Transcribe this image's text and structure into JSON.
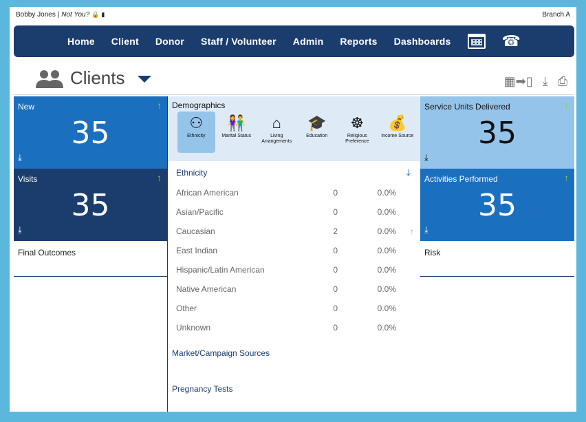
{
  "topbar": {
    "user": "Bobby Jones |",
    "not_you": "Not You?",
    "branch": "Branch A"
  },
  "nav": {
    "items": [
      "Home",
      "Client",
      "Donor",
      "Staff / Volunteer",
      "Admin",
      "Reports",
      "Dashboards"
    ]
  },
  "header": {
    "title": "Clients"
  },
  "tiles": {
    "new": {
      "label": "New",
      "value": "35"
    },
    "visits": {
      "label": "Visits",
      "value": "35"
    },
    "service_units": {
      "label": "Service Units Delivered",
      "value": "35"
    },
    "activities": {
      "label": "Activities Performed",
      "value": "35"
    }
  },
  "left_sections": {
    "final_outcomes": "Final Outcomes"
  },
  "right_sections": {
    "risk": "Risk"
  },
  "demographics": {
    "title": "Demographics",
    "categories": [
      {
        "label": "Ethnicity",
        "icon": "ethnicity-icon"
      },
      {
        "label": "Marital Status",
        "icon": "marital-status-icon"
      },
      {
        "label": "Living Arrangements",
        "icon": "living-arrangements-icon"
      },
      {
        "label": "Education",
        "icon": "education-icon"
      },
      {
        "label": "Religious Preference",
        "icon": "religious-preference-icon"
      },
      {
        "label": "Income Source",
        "icon": "income-source-icon"
      }
    ]
  },
  "ethnicity": {
    "title": "Ethnicity",
    "rows": [
      {
        "name": "African American",
        "count": "0",
        "pct": "0.0%",
        "up": ""
      },
      {
        "name": "Asian/Pacific",
        "count": "0",
        "pct": "0.0%",
        "up": ""
      },
      {
        "name": "Caucasian",
        "count": "2",
        "pct": "0.0%",
        "up": "↑"
      },
      {
        "name": "East Indian",
        "count": "0",
        "pct": "0.0%",
        "up": ""
      },
      {
        "name": "Hispanic/Latin American",
        "count": "0",
        "pct": "0.0%",
        "up": ""
      },
      {
        "name": "Native American",
        "count": "0",
        "pct": "0.0%",
        "up": ""
      },
      {
        "name": "Other",
        "count": "0",
        "pct": "0.0%",
        "up": ""
      },
      {
        "name": "Unknown",
        "count": "0",
        "pct": "0.0%",
        "up": ""
      }
    ]
  },
  "sections": {
    "market": "Market/Campaign Sources",
    "pregnancy": "Pregnancy Tests"
  },
  "colors": {
    "navy": "#1b3d6d",
    "blue": "#1b6fbf",
    "light_blue": "#95c4ea",
    "green_arrow": "#7fd14a"
  }
}
